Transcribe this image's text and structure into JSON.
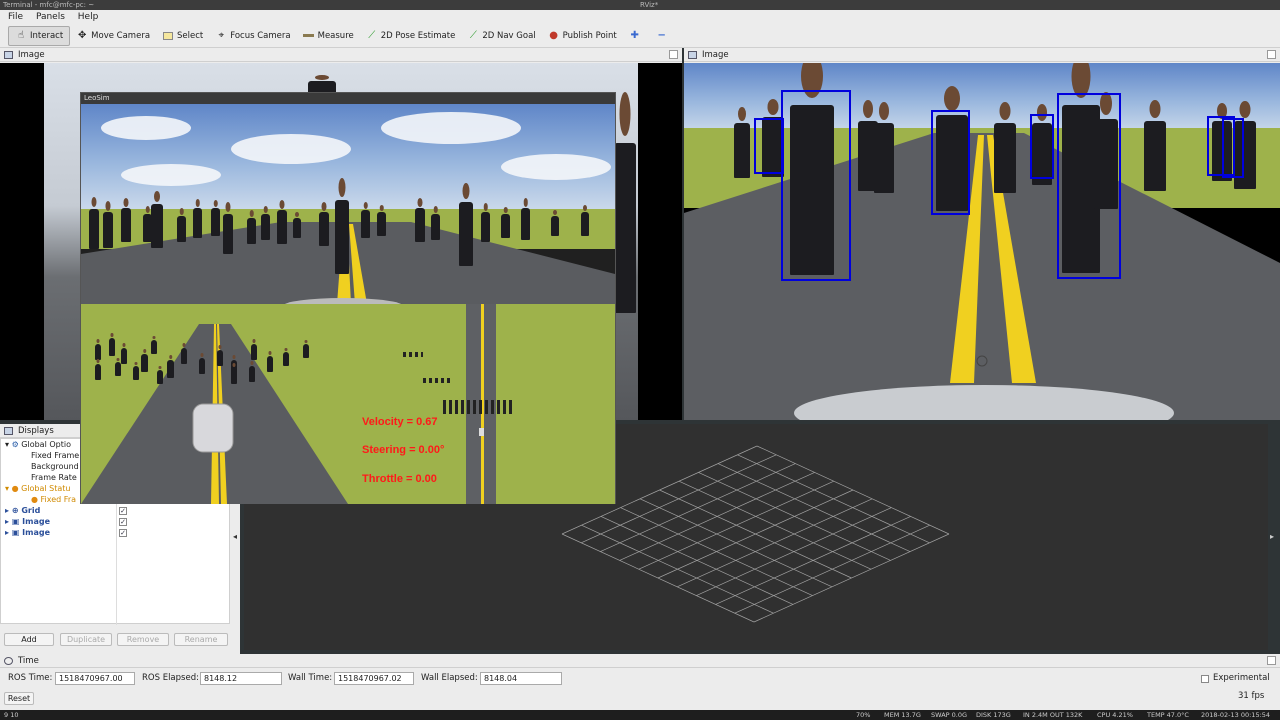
{
  "window": {
    "terminal_title": "Terminal - mfc@mfc-pc: ~",
    "app_title": "RViz*"
  },
  "menu": [
    "File",
    "Panels",
    "Help"
  ],
  "toolbar": {
    "interact": "Interact",
    "move_camera": "Move Camera",
    "select": "Select",
    "focus_camera": "Focus Camera",
    "measure": "Measure",
    "pose_estimate": "2D Pose Estimate",
    "nav_goal": "2D Nav Goal",
    "publish_point": "Publish Point"
  },
  "left_panel": {
    "title": "Image"
  },
  "right_panel": {
    "title": "Image"
  },
  "leosim": {
    "title": "LeoSim",
    "velocity": "Velocity = 0.67",
    "steering": "Steering = 0.00°",
    "throttle": "Throttle = 0.00"
  },
  "displays": {
    "title": "Displays",
    "items": [
      "Global Optio",
      "Fixed Frame",
      "Background",
      "Frame Rate",
      "Global Statu",
      "Fixed Fra",
      "Grid",
      "Image",
      "Image"
    ],
    "buttons": {
      "add": "Add",
      "duplicate": "Duplicate",
      "remove": "Remove",
      "rename": "Rename"
    }
  },
  "time_panel": {
    "title": "Time",
    "ros_time_label": "ROS Time:",
    "ros_time": "1518470967.00",
    "ros_elapsed_label": "ROS Elapsed:",
    "ros_elapsed": "8148.12",
    "wall_time_label": "Wall Time:",
    "wall_time": "1518470967.02",
    "wall_elapsed_label": "Wall Elapsed:",
    "wall_elapsed": "8148.04",
    "experimental": "Experimental",
    "reset": "Reset",
    "fps": "31 fps"
  },
  "statusbar": {
    "left": "9  10",
    "volume": "70%",
    "mem": "MEM 13.7G",
    "swap": "SWAP 0.0G",
    "disk": "DISK 173G",
    "net": "IN 2.4M OUT 132K",
    "cpu": "CPU 4.21%",
    "temp": "TEMP 47.0°C",
    "clock": "2018-02-13 00:15:54"
  }
}
